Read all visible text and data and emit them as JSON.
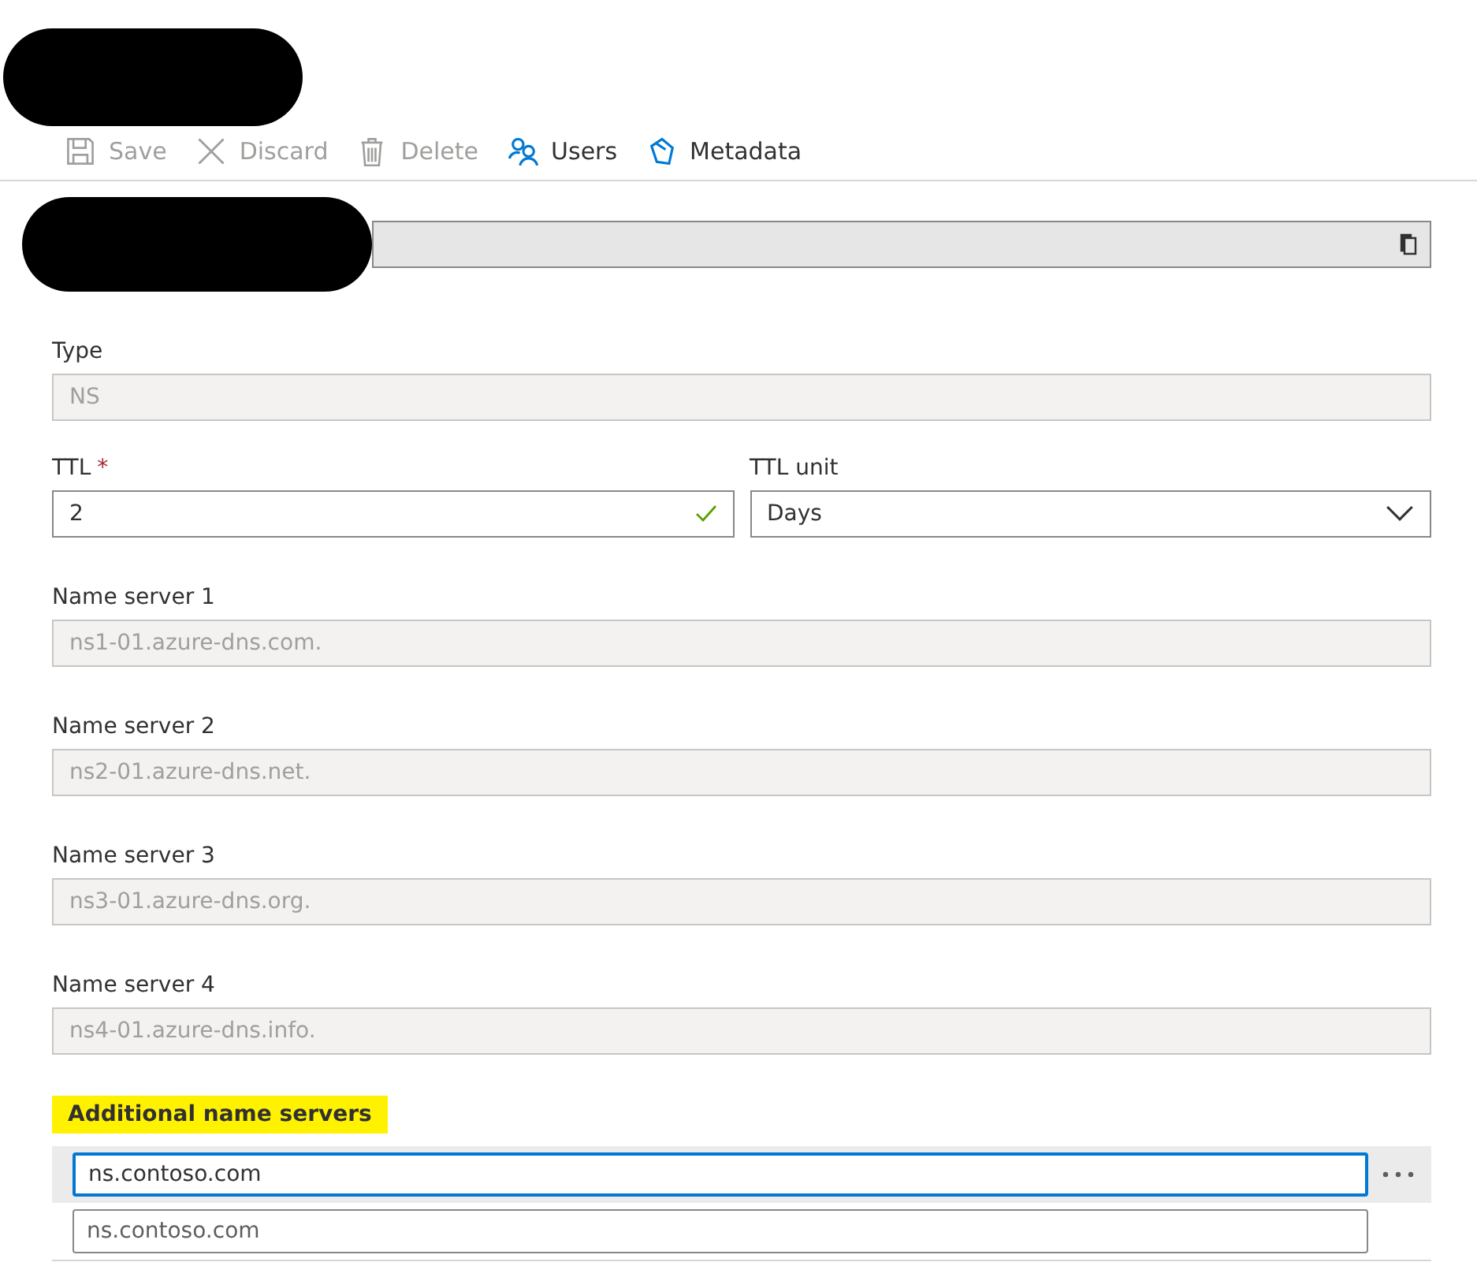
{
  "header": {
    "redacted": true
  },
  "toolbar": [
    {
      "label": "Save",
      "disabled": true
    },
    {
      "label": "Discard",
      "disabled": true
    },
    {
      "label": "Delete",
      "disabled": true
    },
    {
      "label": "Users",
      "disabled": false
    },
    {
      "label": "Metadata",
      "disabled": false
    }
  ],
  "name_field": {
    "redacted": true
  },
  "type_field": {
    "label": "Type",
    "value": "NS",
    "disabled": true
  },
  "ttl": {
    "label": "TTL",
    "required_mark": "*",
    "value": "2",
    "valid": true
  },
  "ttl_unit": {
    "label": "TTL unit",
    "value": "Days"
  },
  "name_servers": [
    {
      "label": "Name server 1",
      "value": "ns1-01.azure-dns.com.",
      "disabled": true
    },
    {
      "label": "Name server 2",
      "value": "ns2-01.azure-dns.net.",
      "disabled": true
    },
    {
      "label": "Name server 3",
      "value": "ns3-01.azure-dns.org.",
      "disabled": true
    },
    {
      "label": "Name server 4",
      "value": "ns4-01.azure-dns.info.",
      "disabled": true
    }
  ],
  "additional": {
    "label": "Additional name servers",
    "highlighted": true,
    "rows": [
      {
        "value": "ns.contoso.com",
        "focused": true,
        "selected": true
      },
      {
        "placeholder": "ns.contoso.com",
        "focused": false,
        "selected": false
      }
    ]
  }
}
